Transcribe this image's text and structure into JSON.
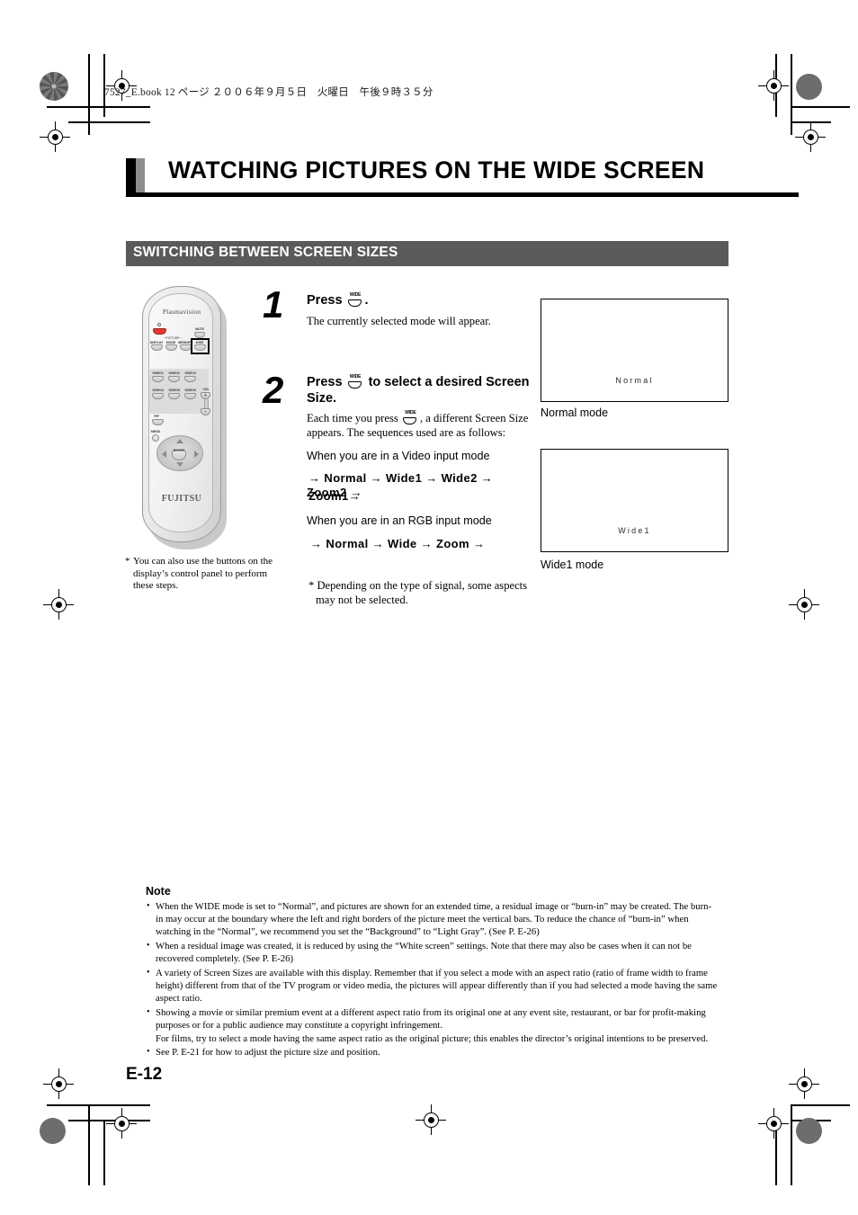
{
  "print": {
    "meta_line": "7527_E.book  12 ページ  ２００６年９月５日　火曜日　午後９時３５分"
  },
  "header": {
    "title": "WATCHING PICTURES ON THE WIDE SCREEN",
    "section_bar": "SWITCHING BETWEEN SCREEN SIZES"
  },
  "steps": [
    {
      "number": "1",
      "heading_before": "Press",
      "heading_after": ".",
      "body": "The currently selected mode will appear."
    },
    {
      "number": "2",
      "heading_before": "Press",
      "heading_after": "to select a desired Screen Size.",
      "body_lead_a": "Each time you press",
      "body_lead_b": ", a different Screen Size appears.  The sequences used are as follows:",
      "video_label": "When you are in a Video input mode",
      "video_sequence_line1": "→ Normal →  Wide1 →  Wide2 →  Zoom1→",
      "video_sequence_line2": "Zoom2 →",
      "rgb_label": "When you are in an RGB input mode",
      "rgb_sequence": "→ Normal  → Wide  → Zoom  →",
      "footnote": "* Depending on the type of signal, some aspects may not be selected."
    }
  ],
  "key": {
    "wide_label": "WIDE"
  },
  "screens": [
    {
      "osd_text": "Normal",
      "caption": "Normal mode"
    },
    {
      "osd_text": "Wide1",
      "caption": "Wide1 mode"
    }
  ],
  "remote": {
    "brand_top": "Plasmavision",
    "brand_bottom": "FUJITSU",
    "keys_row1": [
      "DISPLAY",
      "MODE",
      "MEMORY",
      "WIDE"
    ],
    "mute_label": "MUTE",
    "picture_bracket": "─PICTURE─",
    "keys_inputs": [
      "VIDEO1",
      "VIDEO2",
      "VIDEO3",
      "VIDEO4",
      "VIDEO5",
      "VIDEO6"
    ],
    "pip_label": "PIP",
    "menu_label": "MENU",
    "enter_label": "ENTER",
    "vol_label": "VOL",
    "vol_plus": "+",
    "vol_minus": "−",
    "highlighted_key": "WIDE",
    "footnote_star": "*",
    "footnote_text": "You can also use the buttons on the display’s control panel to perform these steps."
  },
  "note": {
    "title": "Note",
    "items": [
      {
        "text": "When the WIDE mode is set to “Normal”, and pictures are shown for an extended time, a residual image or “burn-in” may be created. The burn-in may occur at the boundary where the left and right borders of the picture meet the vertical bars. To reduce the chance of “burn-in” when watching in the “Normal”, we recommend you set the “Background” to “Light Gray”. (See P. E-26)"
      },
      {
        "text": "When a residual image was created, it is reduced by using the “White screen” settings. Note that there may also be cases when it can not be recovered completely. (See P. E-26)"
      },
      {
        "text": "A variety of Screen Sizes are available with this display.  Remember that if you select a mode with an aspect ratio (ratio of frame width to frame height) different from that of the TV program or video media, the pictures will appear differently than if you had selected a mode having the same aspect ratio."
      },
      {
        "text": "Showing a movie or similar premium event at a different aspect ratio from its original one at any event site, restaurant, or bar for profit-making purposes or for a public audience may constitute a copyright infringement.",
        "cont": "For films, try to select a mode having the same aspect ratio as the original picture; this enables the director’s original intentions to be preserved."
      },
      {
        "text": "See P. E-21 for how to adjust the picture size and position."
      }
    ]
  },
  "footer": {
    "page_number": "E-12"
  }
}
